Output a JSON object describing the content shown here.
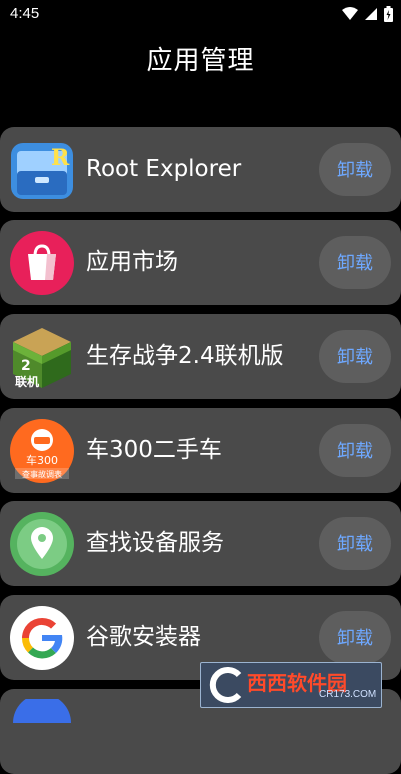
{
  "status_bar": {
    "time": "4:45",
    "icons": [
      "wifi-icon",
      "cellular-signal-icon",
      "battery-icon"
    ]
  },
  "page": {
    "title": "应用管理"
  },
  "apps": [
    {
      "name": "Root Explorer",
      "button": "卸载",
      "icon": "root-explorer-icon"
    },
    {
      "name": "应用市场",
      "button": "卸载",
      "icon": "app-market-icon"
    },
    {
      "name": "生存战争2.4联机版",
      "button": "卸载",
      "icon": "survivalcraft-icon",
      "icon_text": [
        "2",
        "联机"
      ]
    },
    {
      "name": "车300二手车",
      "button": "卸载",
      "icon": "che300-icon",
      "icon_text": [
        "车300",
        "查事故调表"
      ]
    },
    {
      "name": "查找设备服务",
      "button": "卸载",
      "icon": "find-device-icon"
    },
    {
      "name": "谷歌安装器",
      "button": "卸载",
      "icon": "google-installer-icon"
    }
  ],
  "watermark": {
    "text": "西西软件园",
    "sub": "CR173.COM"
  },
  "colors": {
    "background": "#000000",
    "row": "#4a4a4a",
    "button_bg": "#5e5e5e",
    "button_text": "#6ea8ff"
  }
}
